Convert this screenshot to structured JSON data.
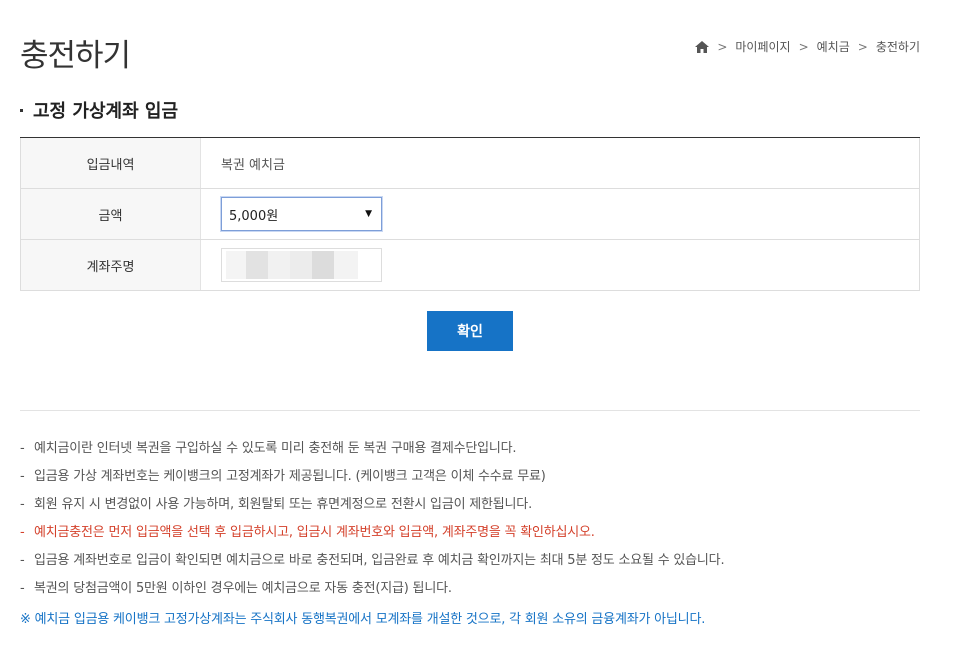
{
  "header": {
    "title": "충전하기",
    "breadcrumb": [
      "마이페이지",
      "예치금",
      "충전하기"
    ]
  },
  "section": {
    "title": "고정 가상계좌 입금"
  },
  "form": {
    "deposit_label": "입금내역",
    "deposit_value": "복권 예치금",
    "amount_label": "금액",
    "amount_selected": "5,000원",
    "account_name_label": "계좌주명"
  },
  "confirm_label": "확인",
  "notes": [
    "예치금이란 인터넷 복권을 구입하실 수 있도록 미리 충전해 둔 복권 구매용 결제수단입니다.",
    "입금용 가상 계좌번호는 케이뱅크의 고정계좌가 제공됩니다. (케이뱅크 고객은 이체 수수료 무료)",
    "회원 유지 시 변경없이 사용 가능하며, 회원탈퇴 또는 휴면계정으로 전환시 입금이 제한됩니다.",
    "예치금충전은 먼저 입금액을 선택 후 입금하시고, 입금시 계좌번호와 입금액, 계좌주명을 꼭 확인하십시오.",
    "입금용 계좌번호로 입금이 확인되면 예치금으로 바로 충전되며, 입금완료 후 예치금 확인까지는 최대 5분 정도 소요될 수 있습니다.",
    "복권의 당첨금액이 5만원 이하인 경우에는 예치금으로 자동 충전(지급) 됩니다."
  ],
  "notes_footer": "※ 예치금 입금용 케이뱅크 고정가상계좌는 주식회사 동행복권에서 모계좌를 개설한 것으로, 각 회원 소유의 금융계좌가 아닙니다.",
  "colors": {
    "accent": "#1673c6",
    "warning": "#d4412b"
  }
}
